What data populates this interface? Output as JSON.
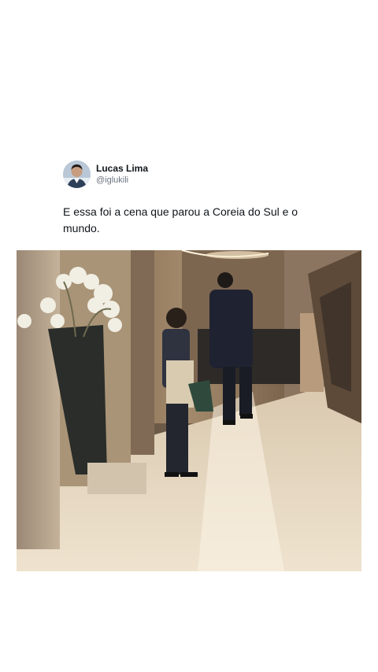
{
  "tweet": {
    "author": {
      "display_name": "Lucas Lima",
      "handle": "@iglukili"
    },
    "text": "E essa foi a cena que parou a Coreia do Sul e o mundo."
  },
  "media": {
    "type": "photo",
    "description_icon": "photo-icon"
  }
}
